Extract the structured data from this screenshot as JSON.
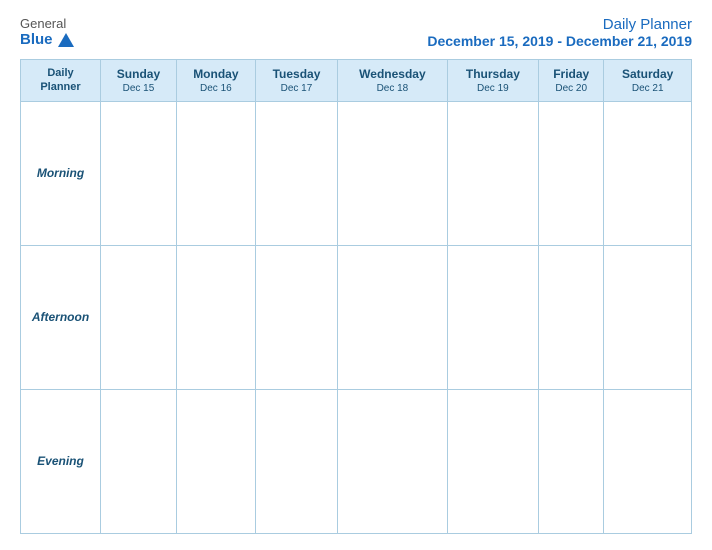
{
  "header": {
    "logo": {
      "general": "General",
      "blue": "Blue"
    },
    "title": "Daily Planner",
    "date_range": "December 15, 2019 - December 21, 2019"
  },
  "table": {
    "header_col": {
      "line1": "Daily",
      "line2": "Planner"
    },
    "columns": [
      {
        "day": "Sunday",
        "date": "Dec 15"
      },
      {
        "day": "Monday",
        "date": "Dec 16"
      },
      {
        "day": "Tuesday",
        "date": "Dec 17"
      },
      {
        "day": "Wednesday",
        "date": "Dec 18"
      },
      {
        "day": "Thursday",
        "date": "Dec 19"
      },
      {
        "day": "Friday",
        "date": "Dec 20"
      },
      {
        "day": "Saturday",
        "date": "Dec 21"
      }
    ],
    "rows": [
      {
        "label": "Morning"
      },
      {
        "label": "Afternoon"
      },
      {
        "label": "Evening"
      }
    ]
  }
}
